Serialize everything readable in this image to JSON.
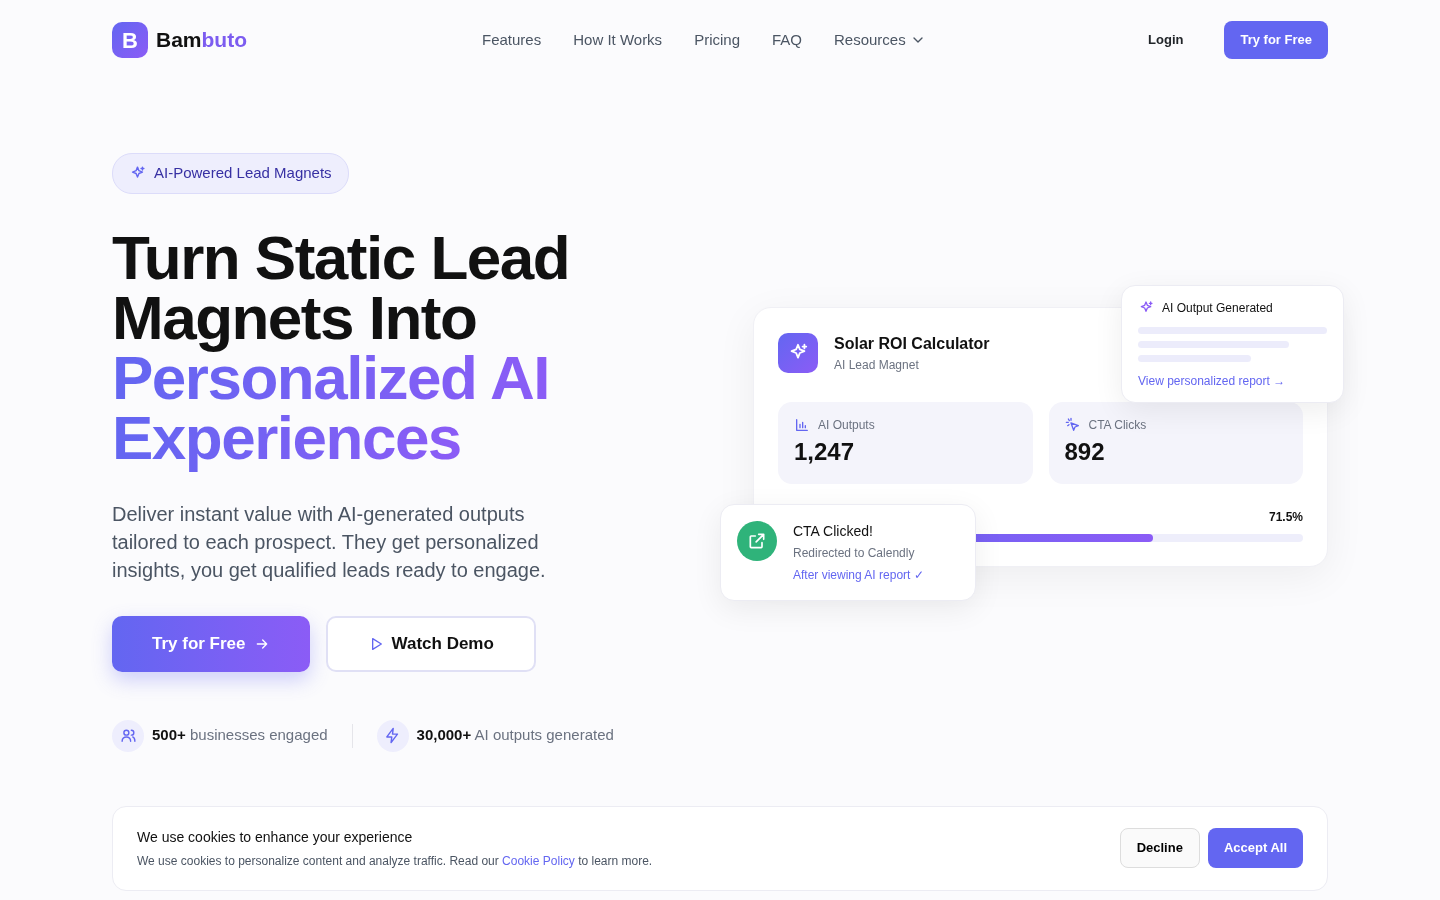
{
  "brand": {
    "logo_letter": "B",
    "name_part1": "Bam",
    "name_part2": "buto"
  },
  "nav": {
    "links": [
      {
        "label": "Features",
        "dropdown": false
      },
      {
        "label": "How It Works",
        "dropdown": false
      },
      {
        "label": "Pricing",
        "dropdown": false
      },
      {
        "label": "FAQ",
        "dropdown": false
      },
      {
        "label": "Resources",
        "dropdown": true
      }
    ],
    "login": "Login",
    "cta": "Try for Free"
  },
  "hero": {
    "badge": "AI-Powered Lead Magnets",
    "title_dark": [
      "Turn Static Lead",
      "Magnets Into"
    ],
    "title_accent": [
      "Personalized AI",
      "Experiences"
    ],
    "description": "Deliver instant value with AI-generated outputs tailored to each prospect. They get personalized insights, you get qualified leads ready to engage.",
    "primary_button": "Try for Free",
    "secondary_button": "Watch Demo",
    "stats": [
      {
        "kind": "users",
        "value": "500+",
        "label": "businesses engaged"
      },
      {
        "kind": "bolt",
        "value": "30,000+",
        "label": "AI outputs generated"
      }
    ]
  },
  "dashboard": {
    "title": "Solar ROI Calculator",
    "subtitle": "AI Lead Magnet",
    "metrics": [
      {
        "kind": "chart",
        "label": "AI Outputs",
        "value": "1,247"
      },
      {
        "kind": "click",
        "label": "CTA Clicks",
        "value": "892"
      }
    ],
    "progress": {
      "reading": "71.5%",
      "level": 0.715
    },
    "output_card": {
      "title": "AI Output Generated",
      "link": "View personalized report →"
    },
    "toast": {
      "title": "CTA Clicked!",
      "subtitle": "Redirected to Calendly",
      "note": "After viewing AI report ✓"
    }
  },
  "cookie": {
    "title": "We use cookies to enhance your experience",
    "text_before": "We use cookies to personalize content and analyze traffic. Read our",
    "link": "Cookie Policy",
    "text_after": "to learn more.",
    "decline": "Decline",
    "accept": "Accept All"
  }
}
